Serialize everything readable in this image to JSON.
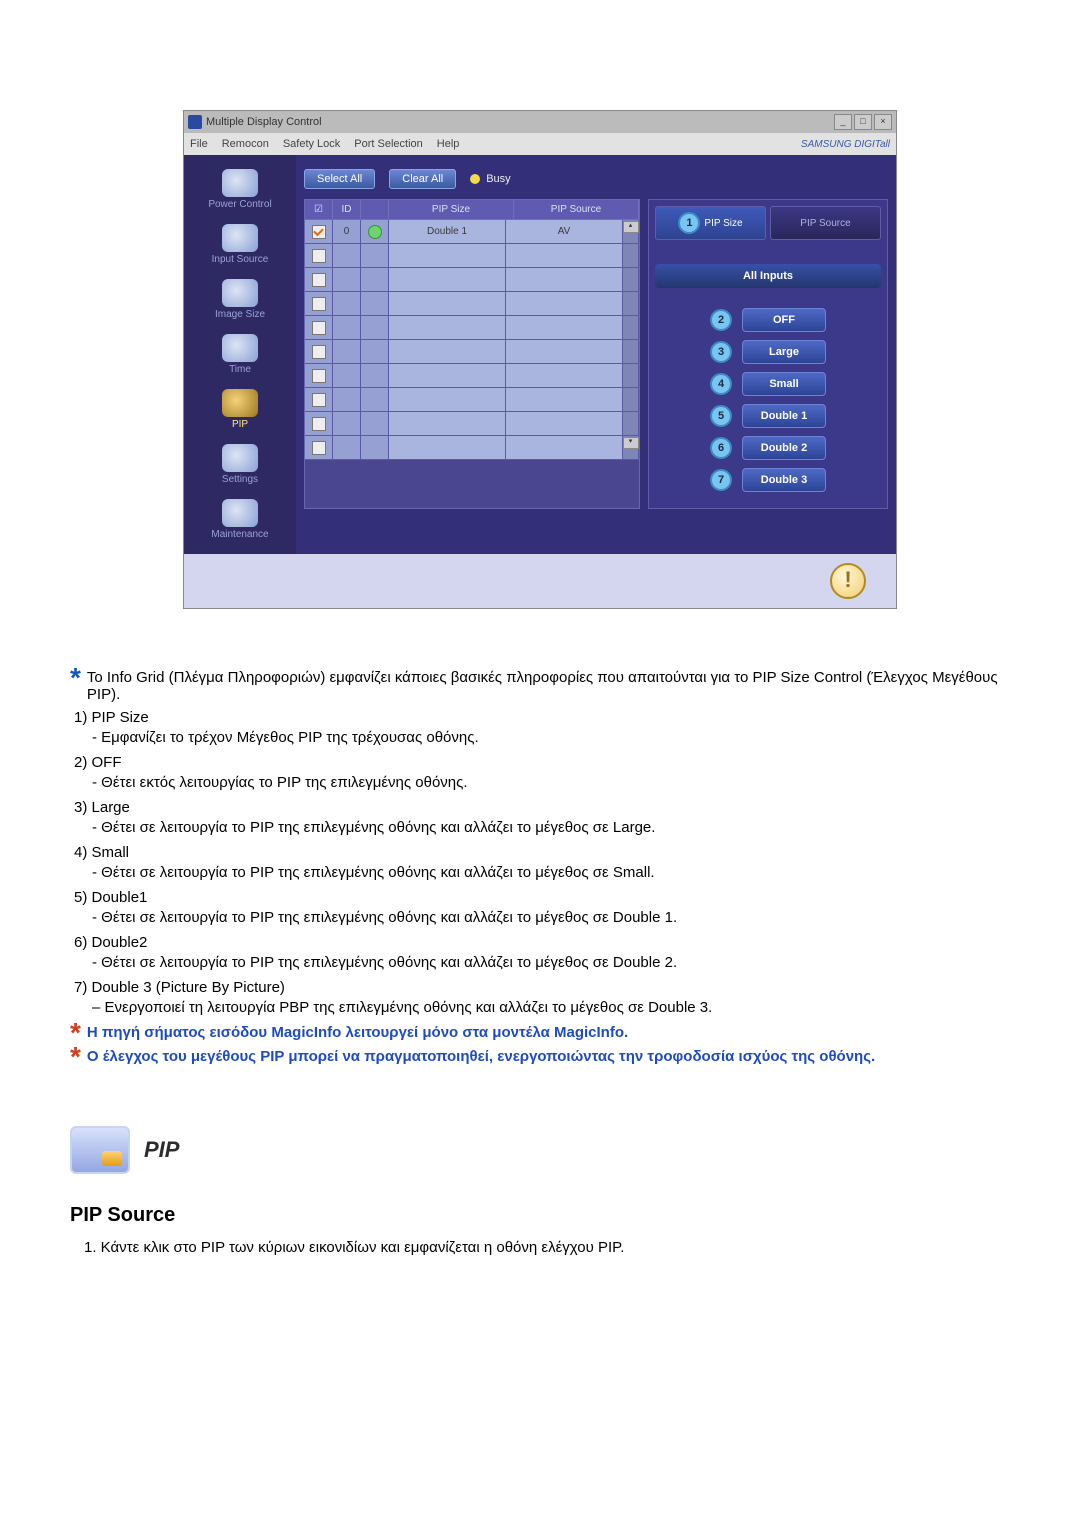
{
  "window": {
    "title": "Multiple Display Control",
    "menus": [
      "File",
      "Remocon",
      "Safety Lock",
      "Port Selection",
      "Help"
    ],
    "brand": "SAMSUNG DIGITall",
    "win_btns": [
      "_",
      "□",
      "×"
    ]
  },
  "sidebar": {
    "items": [
      {
        "label": "Power Control"
      },
      {
        "label": "Input Source"
      },
      {
        "label": "Image Size"
      },
      {
        "label": "Time"
      },
      {
        "label": "PIP"
      },
      {
        "label": "Settings"
      },
      {
        "label": "Maintenance"
      }
    ]
  },
  "toolbar": {
    "select_all": "Select All",
    "clear_all": "Clear All",
    "busy": "Busy"
  },
  "grid": {
    "headers": {
      "chk": "☑",
      "id": "ID",
      "stat": "",
      "pip_size": "PIP Size",
      "pip_source": "PIP Source"
    },
    "row1": {
      "id": "0",
      "pip_size": "Double 1",
      "pip_source": "AV"
    }
  },
  "right_panel": {
    "tab1_badge": "1",
    "tab1_label": "PIP Size",
    "tab2_label": "PIP Source",
    "all_inputs": "All Inputs",
    "options": [
      {
        "n": "2",
        "label": "OFF"
      },
      {
        "n": "3",
        "label": "Large"
      },
      {
        "n": "4",
        "label": "Small"
      },
      {
        "n": "5",
        "label": "Double 1"
      },
      {
        "n": "6",
        "label": "Double 2"
      },
      {
        "n": "7",
        "label": "Double 3"
      }
    ]
  },
  "footer_warn": "!",
  "explain": {
    "intro": "Το Info Grid (Πλέγμα Πληροφοριών) εμφανίζει κάποιες βασικές πληροφορίες που απαιτούνται για το PIP Size Control (Έλεγχος Μεγέθους PIP).",
    "items": [
      {
        "h": "1)  PIP Size",
        "d": "- Εμφανίζει το τρέχον Μέγεθος PIP της τρέχουσας οθόνης."
      },
      {
        "h": "2)  OFF",
        "d": "- Θέτει εκτός λειτουργίας το PIP της επιλεγμένης οθόνης."
      },
      {
        "h": "3)  Large",
        "d": "- Θέτει σε λειτουργία το PIP της επιλεγμένης οθόνης και αλλάζει το μέγεθος σε Large."
      },
      {
        "h": "4)  Small",
        "d": "- Θέτει σε λειτουργία το PIP της επιλεγμένης οθόνης και αλλάζει το μέγεθος σε Small."
      },
      {
        "h": "5)  Double1",
        "d": "- Θέτει σε λειτουργία το PIP της επιλεγμένης οθόνης και αλλάζει το μέγεθος σε Double 1."
      },
      {
        "h": "6)  Double2",
        "d": "- Θέτει σε λειτουργία το PIP της επιλεγμένης οθόνης και αλλάζει το μέγεθος σε Double 2."
      },
      {
        "h": "7)  Double 3 (Picture By Picture)",
        "d": "– Ενεργοποιεί τη λειτουργία PBP της επιλεγμένης οθόνης και αλλάζει το μέγεθος σε Double 3."
      }
    ],
    "note1": "Η πηγή σήματος εισόδου MagicInfo λειτουργεί μόνο στα μοντέλα MagicInfo.",
    "note2": "Ο έλεγχος του μεγέθους PIP μπορεί να πραγματοποιηθεί, ενεργοποιώντας την τροφοδοσία ισχύος της οθόνης."
  },
  "section": {
    "title": "PIP",
    "subheading": "PIP Source",
    "step1": "1.  Κάντε κλικ στο PIP των κύριων εικονιδίων και εμφανίζεται η οθόνη ελέγχου PIP."
  }
}
